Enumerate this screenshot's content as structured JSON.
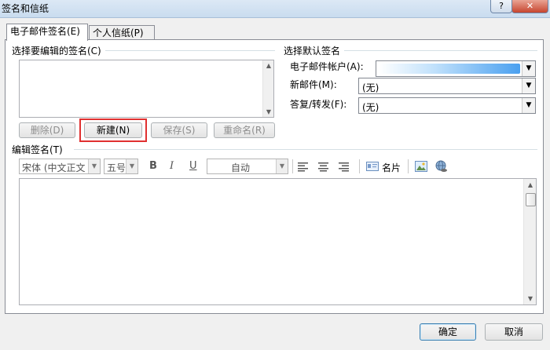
{
  "window": {
    "title": "签名和信纸",
    "help_label": "?",
    "close_label": "✕"
  },
  "tabs": [
    {
      "label": "电子邮件签名(E)"
    },
    {
      "label": "个人信纸(P)"
    }
  ],
  "select_signature": {
    "label": "选择要编辑的签名(C)",
    "buttons": {
      "delete": "删除(D)",
      "new": "新建(N)",
      "save": "保存(S)",
      "rename": "重命名(R)"
    }
  },
  "defaults": {
    "title": "选择默认签名",
    "account_label": "电子邮件帐户(A):",
    "new_mail_label": "新邮件(M):",
    "new_mail_value": "(无)",
    "reply_label": "答复/转发(F):",
    "reply_value": "(无)"
  },
  "edit_signature": {
    "label": "编辑签名(T)",
    "toolbar": {
      "font": "宋体 (中文正文",
      "size": "五号",
      "bold": "B",
      "italic": "I",
      "underline": "U",
      "color": "自动",
      "business_card": "名片"
    }
  },
  "footer": {
    "ok": "确定",
    "cancel": "取消"
  },
  "colors": {
    "accent": "#3c7fb1",
    "highlight": "#e03030",
    "account_fill": "#4aa0f0"
  }
}
